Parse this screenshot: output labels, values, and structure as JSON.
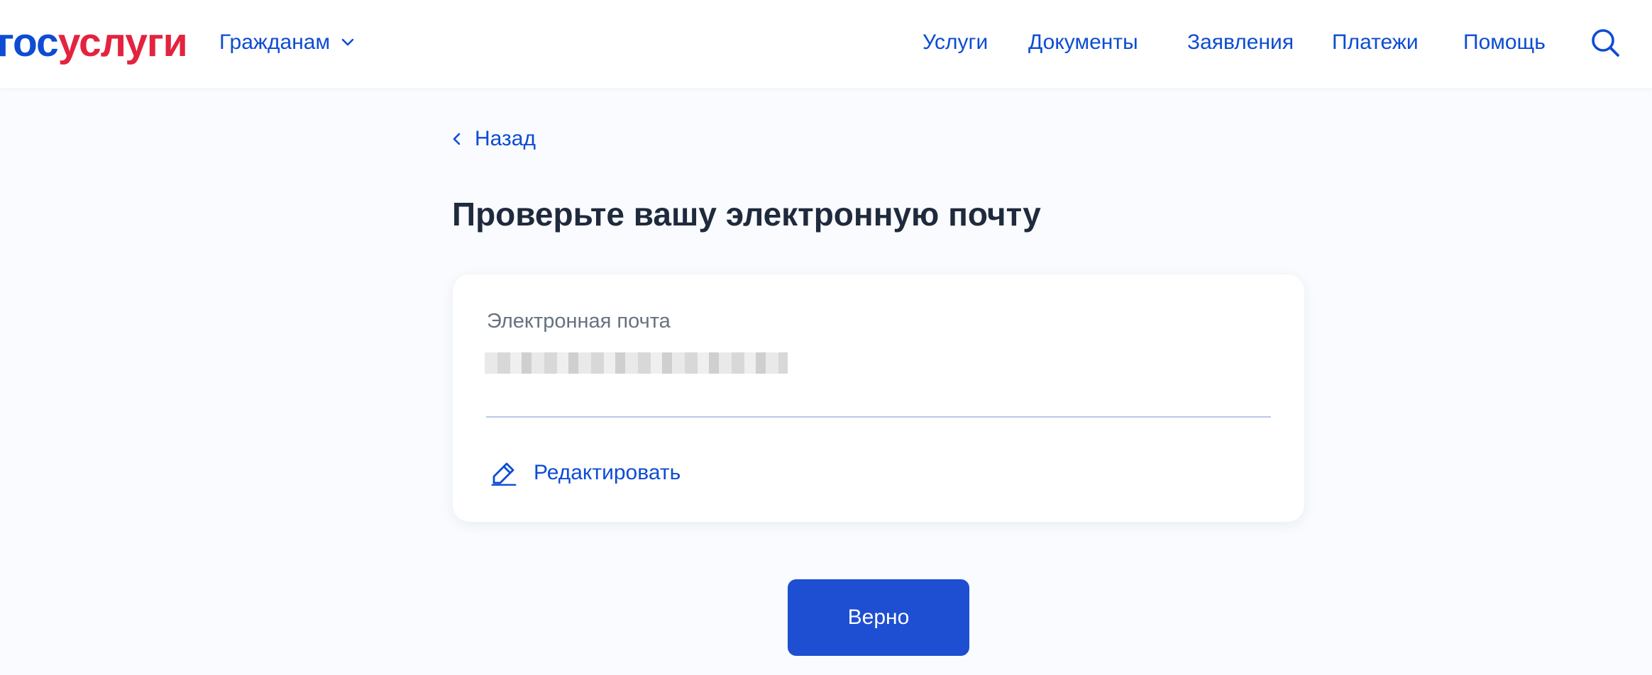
{
  "header": {
    "logo": {
      "part1": "гос",
      "part2": "услуги"
    },
    "audience_menu": "Гражданам",
    "nav": {
      "services": "Услуги",
      "documents": "Документы",
      "applications": "Заявления",
      "payments": "Платежи",
      "help": "Помощь"
    },
    "search_icon": "search-icon"
  },
  "main": {
    "back_label": "Назад",
    "title": "Проверьте вашу электронную почту",
    "card": {
      "field_label": "Электронная почта",
      "field_value": "",
      "edit_label": "Редактировать"
    },
    "confirm_label": "Верно"
  },
  "colors": {
    "brand_blue": "#0d4cd3",
    "brand_red": "#e3233f",
    "button": "#1e4ed1",
    "title": "#1f2a3d",
    "label": "#66727f",
    "background": "#f9fbfe"
  }
}
